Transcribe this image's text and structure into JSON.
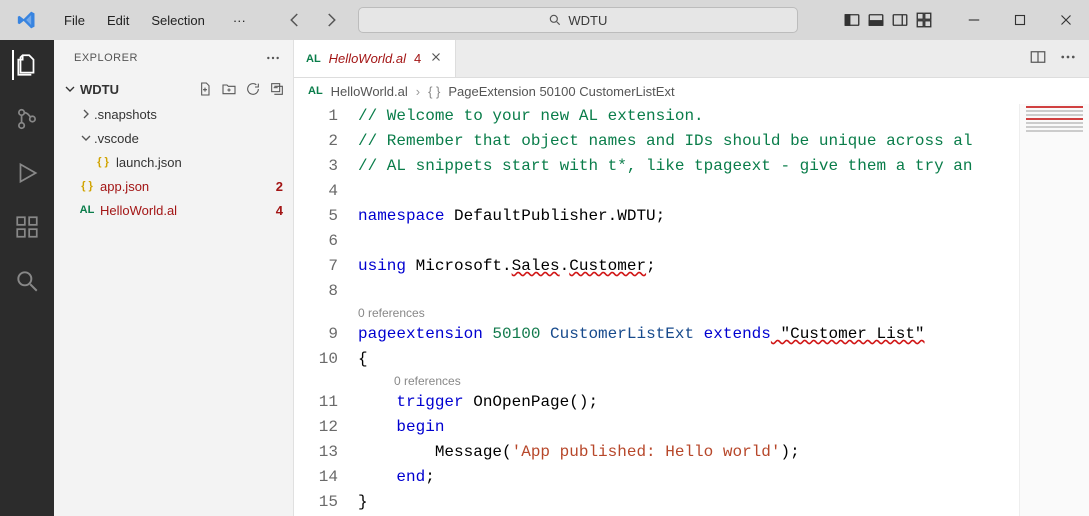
{
  "titlebar": {
    "menu": {
      "file": "File",
      "edit": "Edit",
      "selection": "Selection",
      "more": "···"
    },
    "search_text": "WDTU"
  },
  "sidebar": {
    "title": "EXPLORER",
    "root": "WDTU",
    "tree": {
      "snapshots": ".snapshots",
      "vscode": ".vscode",
      "launch": "launch.json",
      "app": "app.json",
      "app_badge": "2",
      "hello": "HelloWorld.al",
      "hello_badge": "4"
    }
  },
  "tab": {
    "icon": "AL",
    "name": "HelloWorld.al",
    "badge": "4"
  },
  "breadcrumb": {
    "icon": "AL",
    "file": "HelloWorld.al",
    "symbol_brace": "{ }",
    "symbol": "PageExtension 50100 CustomerListExt"
  },
  "code": {
    "line_numbers": [
      "1",
      "2",
      "3",
      "4",
      "5",
      "6",
      "7",
      "8",
      "9",
      "10",
      "11",
      "12",
      "13",
      "14",
      "15"
    ],
    "ref0": "0 references",
    "l1": "// Welcome to your new AL extension.",
    "l2": "// Remember that object names and IDs should be unique across al",
    "l3": "// AL snippets start with t*, like tpageext - give them a try an",
    "l5_kw": "namespace",
    "l5_ns": " DefaultPublisher.WDTU;",
    "l7_kw": "using",
    "l7_ns1": " Microsoft",
    "l7_ns2": "Sales",
    "l7_ns3": "Customer",
    "l9_kw": "pageextension",
    "l9_num": " 50100 ",
    "l9_name": "CustomerListExt ",
    "l9_ext": "extends",
    "l9_tgt": " \"Customer List\"",
    "l10": "{",
    "l11_kw": "trigger",
    "l11_rest": " OnOpenPage();",
    "l12": "begin",
    "l13_a": "Message(",
    "l13_s": "'App published: Hello world'",
    "l13_b": ");",
    "l14": "end",
    "l15": "}"
  }
}
